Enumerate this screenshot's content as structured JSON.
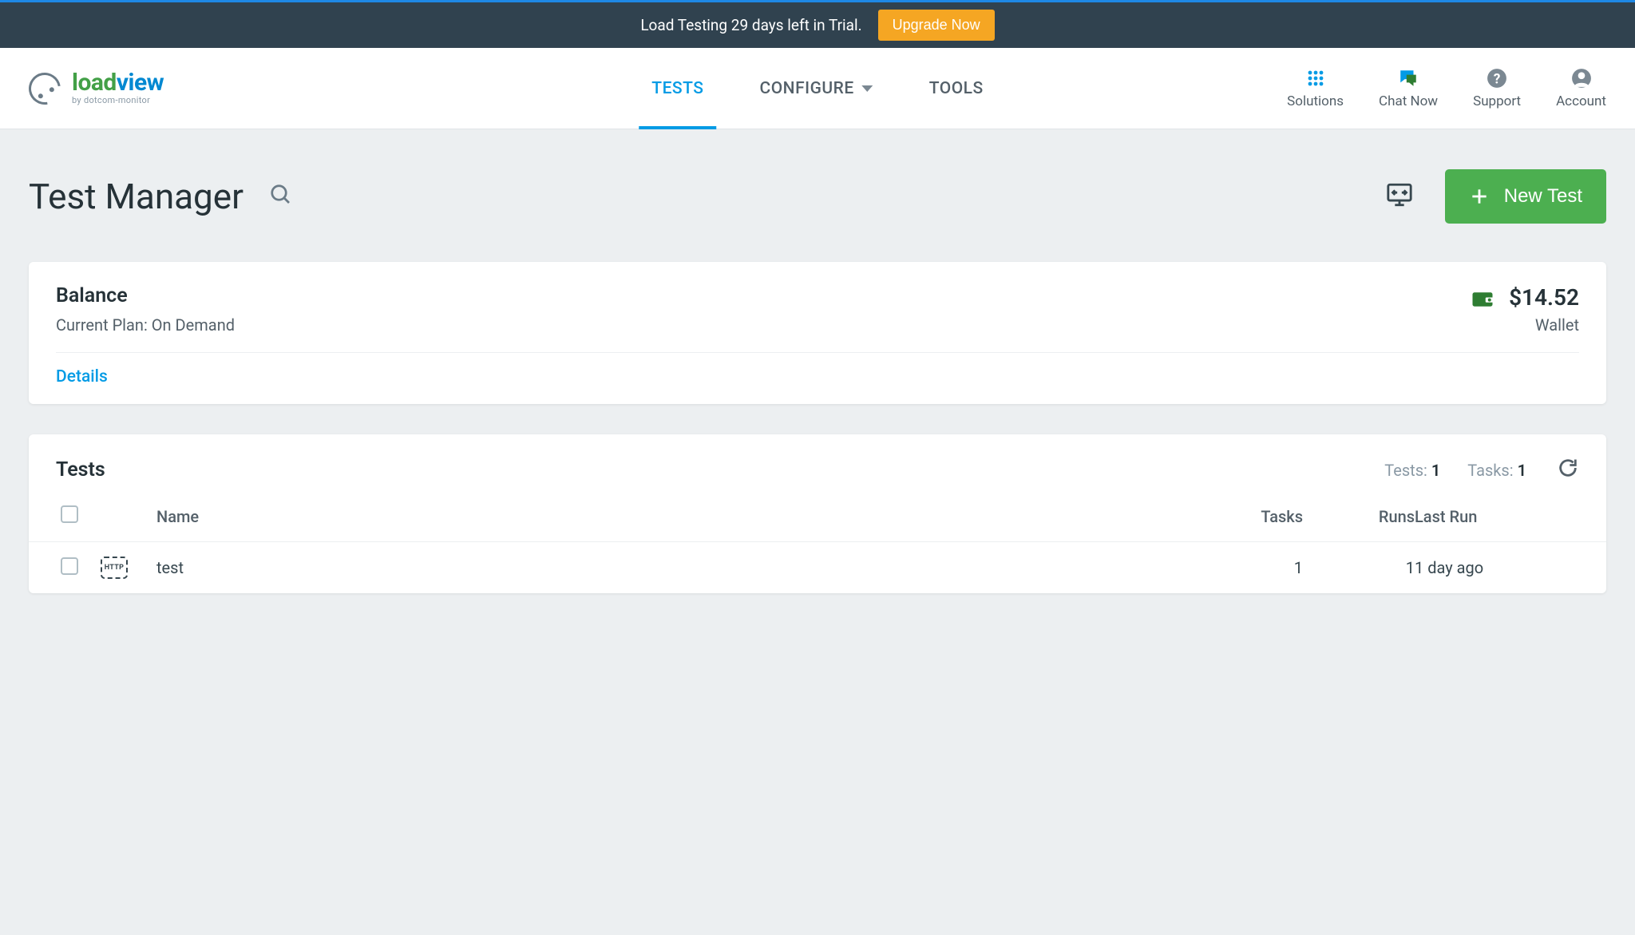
{
  "banner": {
    "message": "Load Testing 29 days left in Trial.",
    "cta": "Upgrade Now"
  },
  "brand": {
    "name_part1": "load",
    "name_part2": "view",
    "byline": "by dotcom-monitor"
  },
  "nav": {
    "tests": "TESTS",
    "configure": "CONFIGURE",
    "tools": "TOOLS"
  },
  "nav_right": {
    "solutions": "Solutions",
    "chat": "Chat Now",
    "support": "Support",
    "account": "Account"
  },
  "page": {
    "title": "Test Manager",
    "new_test": "New Test"
  },
  "balance": {
    "title": "Balance",
    "plan_label": "Current Plan: On Demand",
    "amount": "$14.52",
    "wallet_label": "Wallet",
    "details": "Details"
  },
  "tests_section": {
    "title": "Tests",
    "tests_label": "Tests: ",
    "tests_count": "1",
    "tasks_label": "Tasks: ",
    "tasks_count": "1",
    "columns": {
      "name": "Name",
      "tasks": "Tasks",
      "runs": "Runs",
      "last_run": "Last Run"
    },
    "rows": [
      {
        "icon": "HTTP",
        "name": "test",
        "tasks": "1",
        "runs": "1",
        "last_run": "1 day ago"
      }
    ]
  }
}
